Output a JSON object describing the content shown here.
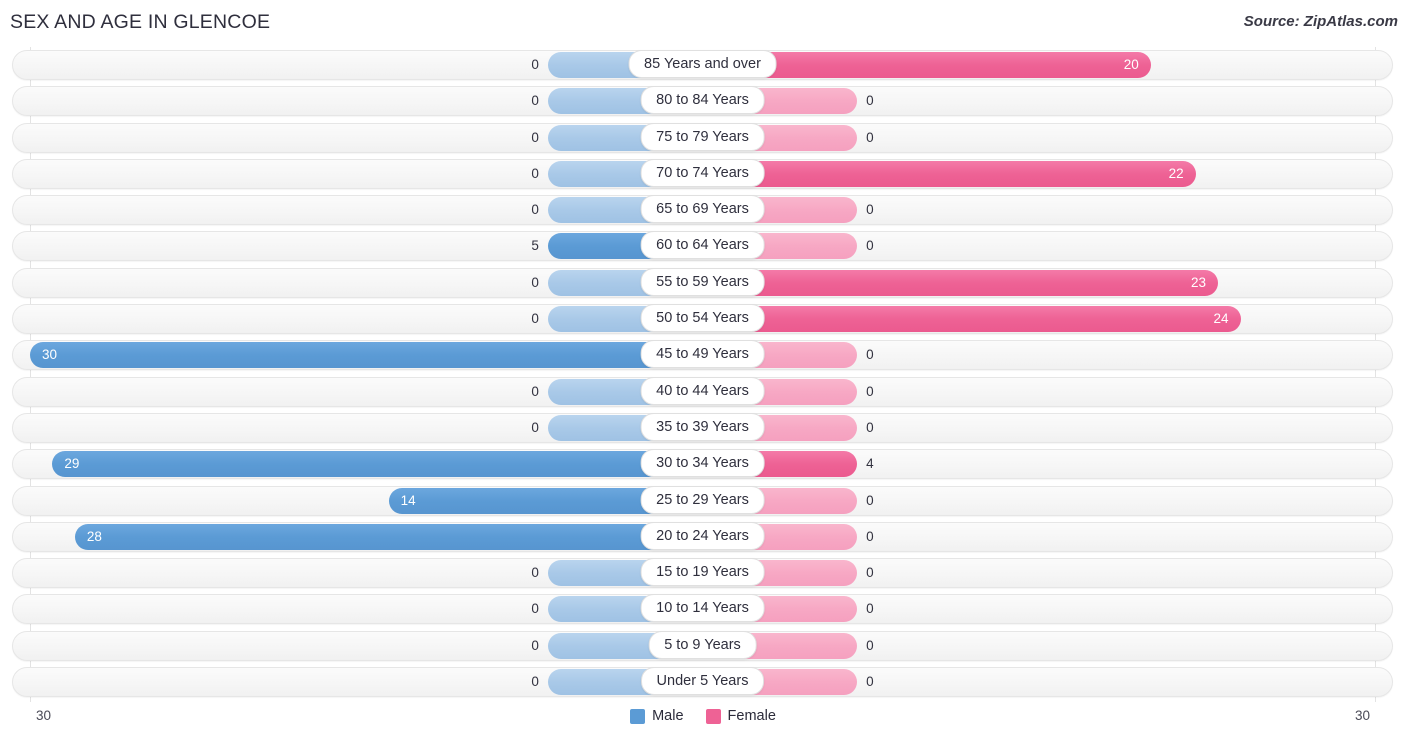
{
  "header": {
    "title": "SEX AND AGE IN GLENCOE",
    "source": "Source: ZipAtlas.com"
  },
  "legend": {
    "male_label": "Male",
    "female_label": "Female",
    "male_color": "#5b9bd5",
    "female_color": "#ee6295"
  },
  "axis": {
    "left_tick": "30",
    "right_tick": "30",
    "max": 30
  },
  "colors": {
    "male_filled": "#5b9bd5",
    "male_empty": "#a9c9e8",
    "female_filled": "#ee6295",
    "female_empty": "#f7a8c4",
    "track": "#f6f6f6",
    "gridline": "#e3e3e3",
    "text": "#2b2b3a"
  },
  "chart_data": {
    "type": "bar",
    "title": "SEX AND AGE IN GLENCOE",
    "subtitle": "",
    "xlabel": "",
    "ylabel": "",
    "orientation": "horizontal",
    "layout": "population-pyramid",
    "legend_position": "bottom-center",
    "grid": true,
    "xlim": [
      0,
      30
    ],
    "categories": [
      "85 Years and over",
      "80 to 84 Years",
      "75 to 79 Years",
      "70 to 74 Years",
      "65 to 69 Years",
      "60 to 64 Years",
      "55 to 59 Years",
      "50 to 54 Years",
      "45 to 49 Years",
      "40 to 44 Years",
      "35 to 39 Years",
      "30 to 34 Years",
      "25 to 29 Years",
      "20 to 24 Years",
      "15 to 19 Years",
      "10 to 14 Years",
      "5 to 9 Years",
      "Under 5 Years"
    ],
    "series": [
      {
        "name": "Male",
        "color": "#5b9bd5",
        "values": [
          0,
          0,
          0,
          0,
          0,
          5,
          0,
          0,
          30,
          0,
          0,
          29,
          14,
          28,
          0,
          0,
          0,
          0
        ]
      },
      {
        "name": "Female",
        "color": "#ee6295",
        "values": [
          20,
          0,
          0,
          22,
          0,
          0,
          23,
          24,
          0,
          0,
          0,
          4,
          0,
          0,
          0,
          0,
          0,
          0
        ]
      }
    ]
  },
  "rows": [
    {
      "label": "85 Years and over",
      "male": "0",
      "female": "20"
    },
    {
      "label": "80 to 84 Years",
      "male": "0",
      "female": "0"
    },
    {
      "label": "75 to 79 Years",
      "male": "0",
      "female": "0"
    },
    {
      "label": "70 to 74 Years",
      "male": "0",
      "female": "22"
    },
    {
      "label": "65 to 69 Years",
      "male": "0",
      "female": "0"
    },
    {
      "label": "60 to 64 Years",
      "male": "5",
      "female": "0"
    },
    {
      "label": "55 to 59 Years",
      "male": "0",
      "female": "23"
    },
    {
      "label": "50 to 54 Years",
      "male": "0",
      "female": "24"
    },
    {
      "label": "45 to 49 Years",
      "male": "30",
      "female": "0"
    },
    {
      "label": "40 to 44 Years",
      "male": "0",
      "female": "0"
    },
    {
      "label": "35 to 39 Years",
      "male": "0",
      "female": "0"
    },
    {
      "label": "30 to 34 Years",
      "male": "29",
      "female": "4"
    },
    {
      "label": "25 to 29 Years",
      "male": "14",
      "female": "0"
    },
    {
      "label": "20 to 24 Years",
      "male": "28",
      "female": "0"
    },
    {
      "label": "15 to 19 Years",
      "male": "0",
      "female": "0"
    },
    {
      "label": "10 to 14 Years",
      "male": "0",
      "female": "0"
    },
    {
      "label": "5 to 9 Years",
      "male": "0",
      "female": "0"
    },
    {
      "label": "Under 5 Years",
      "male": "0",
      "female": "0"
    }
  ]
}
